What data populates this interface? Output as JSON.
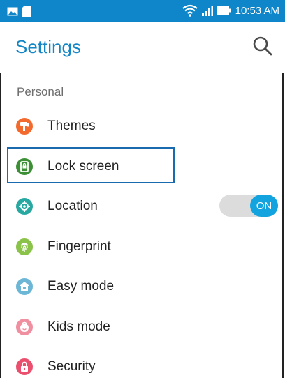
{
  "statusbar": {
    "time": "10:53 AM",
    "icons": [
      "image-icon",
      "sd-card-icon",
      "wifi-icon",
      "signal-icon",
      "battery-icon"
    ]
  },
  "appbar": {
    "title": "Settings",
    "search_icon": "search-icon"
  },
  "section": {
    "label": "Personal"
  },
  "items": [
    {
      "label": "Themes",
      "icon": "themes-icon",
      "color": "#f26a2e"
    },
    {
      "label": "Lock screen",
      "icon": "lock-screen-icon",
      "color": "#3d8f36"
    },
    {
      "label": "Location",
      "icon": "location-icon",
      "color": "#27a8a0",
      "toggle": "ON"
    },
    {
      "label": "Fingerprint",
      "icon": "fingerprint-icon",
      "color": "#8bc34a"
    },
    {
      "label": "Easy mode",
      "icon": "easy-mode-icon",
      "color": "#6cb6d6"
    },
    {
      "label": "Kids mode",
      "icon": "kids-mode-icon",
      "color": "#f08fa0"
    },
    {
      "label": "Security",
      "icon": "security-icon",
      "color": "#ea4f6e"
    }
  ],
  "colors": {
    "statusbar": "#0e86c9",
    "accent": "#1386c6",
    "toggle_on": "#13a3df"
  }
}
